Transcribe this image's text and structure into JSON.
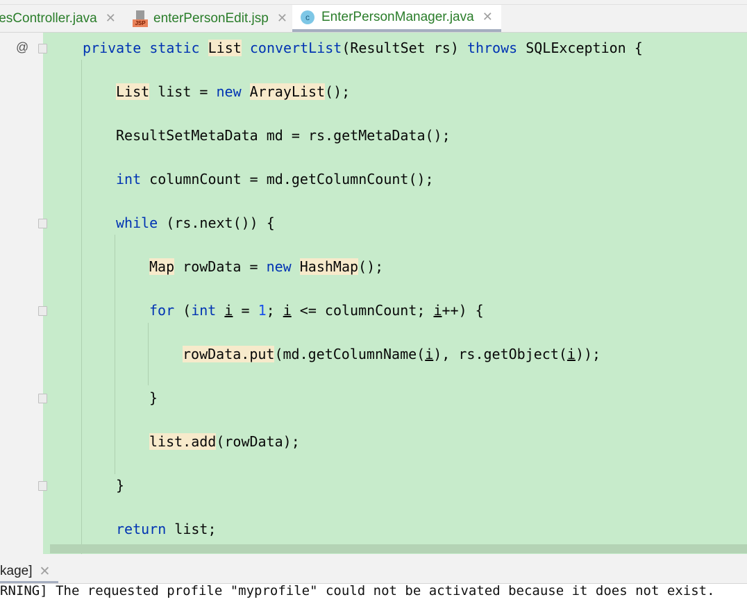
{
  "tabs": [
    {
      "label": "lesController.java",
      "icon": "none"
    },
    {
      "label": "enterPersonEdit.jsp",
      "icon": "jsp-file-icon",
      "icon_text": "JSP"
    },
    {
      "label": "EnterPersonManager.java",
      "icon": "java-class-icon",
      "icon_text": "c",
      "active": true
    }
  ],
  "gutter": {
    "override_marker": "@"
  },
  "code": [
    {
      "indent": 0,
      "tokens": [
        [
          "kw",
          "private"
        ],
        [
          "",
          ""
        ],
        [
          "",
          " "
        ],
        [
          "kw",
          "static"
        ],
        [
          "",
          " "
        ],
        [
          "hl",
          "List"
        ],
        [
          "",
          " "
        ],
        [
          "kw",
          "convertList"
        ],
        [
          "",
          "(ResultSet rs) "
        ],
        [
          "kw",
          "throws"
        ],
        [
          "",
          " SQLException {"
        ]
      ]
    },
    {
      "indent": 1,
      "tokens": [
        [
          "hl",
          "List"
        ],
        [
          "",
          " list = "
        ],
        [
          "kw",
          "new"
        ],
        [
          "",
          " "
        ],
        [
          "hl",
          "ArrayList"
        ],
        [
          "",
          "();"
        ]
      ]
    },
    {
      "indent": 1,
      "tokens": [
        [
          "",
          "ResultSetMetaData md = rs.getMetaData();"
        ]
      ]
    },
    {
      "indent": 1,
      "tokens": [
        [
          "kw",
          "int"
        ],
        [
          "",
          " columnCount = md.getColumnCount();"
        ]
      ]
    },
    {
      "indent": 1,
      "tokens": [
        [
          "kw",
          "while"
        ],
        [
          "",
          " (rs.next()) {"
        ]
      ]
    },
    {
      "indent": 2,
      "tokens": [
        [
          "hl",
          "Map"
        ],
        [
          "",
          " rowData = "
        ],
        [
          "kw",
          "new"
        ],
        [
          "",
          " "
        ],
        [
          "hl",
          "HashMap"
        ],
        [
          "",
          "();"
        ]
      ]
    },
    {
      "indent": 2,
      "tokens": [
        [
          "kw",
          "for"
        ],
        [
          "",
          " ("
        ],
        [
          "kw",
          "int"
        ],
        [
          "",
          " "
        ],
        [
          "ul",
          "i"
        ],
        [
          "",
          " = "
        ],
        [
          "num",
          "1"
        ],
        [
          "",
          "; "
        ],
        [
          "ul",
          "i"
        ],
        [
          "",
          " <= columnCount; "
        ],
        [
          "ul",
          "i"
        ],
        [
          "",
          "++) {"
        ]
      ]
    },
    {
      "indent": 3,
      "tokens": [
        [
          "hl",
          "rowData.put"
        ],
        [
          "",
          "(md.getColumnName("
        ],
        [
          "ul",
          "i"
        ],
        [
          "",
          "), rs.getObject("
        ],
        [
          "ul",
          "i"
        ],
        [
          "",
          "));"
        ]
      ]
    },
    {
      "indent": 2,
      "tokens": [
        [
          "",
          "}"
        ]
      ]
    },
    {
      "indent": 2,
      "tokens": [
        [
          "hl",
          "list.add"
        ],
        [
          "",
          "(rowData);"
        ]
      ]
    },
    {
      "indent": 1,
      "tokens": [
        [
          "",
          "}"
        ]
      ]
    },
    {
      "indent": 1,
      "tokens": [
        [
          "kw",
          "return"
        ],
        [
          "",
          " list;"
        ]
      ]
    }
  ],
  "bottom_panel": {
    "tab_label": "kage]",
    "console_text": "RNING] The requested profile \"myprofile\" could not be activated because it does not exist."
  },
  "colors": {
    "editor_bg": "#c7ebcb",
    "keyword": "#0033b3",
    "highlight": "#f7eacb",
    "tab_text": "#2a7d2a"
  }
}
